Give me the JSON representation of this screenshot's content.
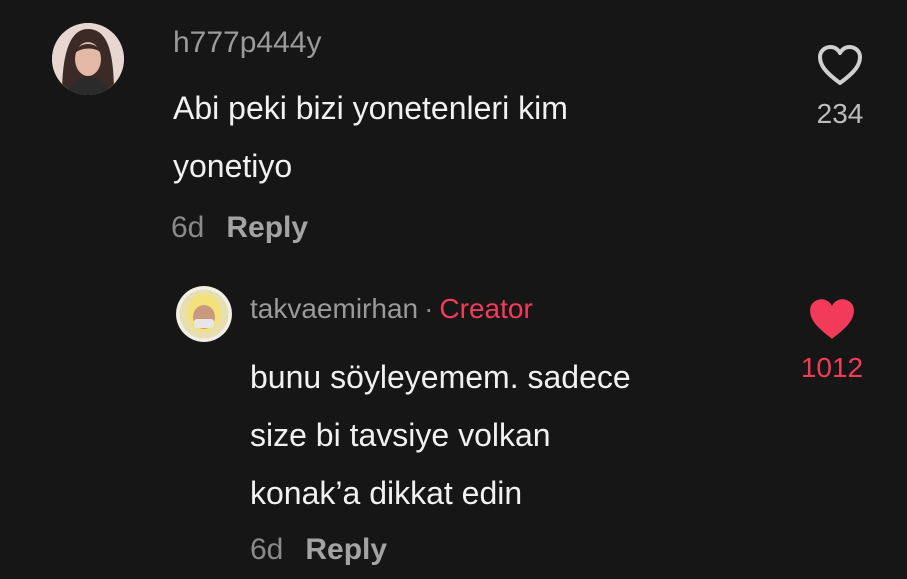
{
  "comments": [
    {
      "username": "h777p444y",
      "lines": [
        "Abi peki bizi yonetenleri kim",
        "yonetiyo"
      ],
      "time": "6d",
      "reply_label": "Reply",
      "likes": "234",
      "liked": false
    }
  ],
  "reply": {
    "username": "takvaemirhan",
    "separator": "·",
    "badge": "Creator",
    "lines": [
      "bunu söyleyemem. sadece",
      "size bi tavsiye volkan",
      "konak’a dikkat edin"
    ],
    "time": "6d",
    "reply_label": "Reply",
    "likes": "1012",
    "liked": true
  },
  "colors": {
    "background": "#161616",
    "liked_heart": "#f23b5a",
    "creator_badge": "#f23b5a"
  }
}
